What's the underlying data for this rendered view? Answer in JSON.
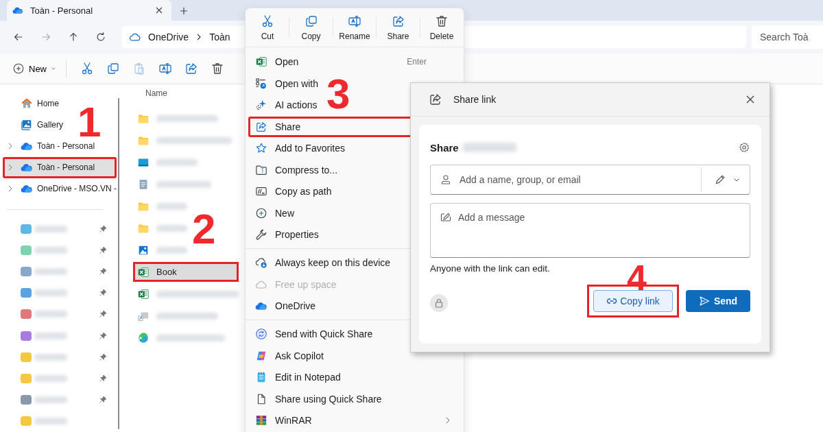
{
  "tab": {
    "title": "Toàn - Personal"
  },
  "address": {
    "crumbs": [
      "OneDrive",
      "Toàn"
    ],
    "search_placeholder": "Search Toà"
  },
  "toolbar": {
    "new_label": "New",
    "buttons": [
      {
        "kind": "cut",
        "disabled": false
      },
      {
        "kind": "copy",
        "disabled": false
      },
      {
        "kind": "paste",
        "disabled": true
      },
      {
        "kind": "rename",
        "disabled": false
      },
      {
        "kind": "share",
        "disabled": false
      },
      {
        "kind": "delete",
        "disabled": false
      }
    ]
  },
  "nav": {
    "items": [
      {
        "label": "Home",
        "kind": "home",
        "expandable": false,
        "selected": false,
        "highlighted": false
      },
      {
        "label": "Gallery",
        "kind": "gallery",
        "expandable": false,
        "selected": false,
        "highlighted": false
      },
      {
        "label": "Toàn - Personal",
        "kind": "onedrive",
        "expandable": true,
        "selected": false,
        "highlighted": false
      },
      {
        "label": "Toàn - Personal",
        "kind": "onedrive",
        "expandable": true,
        "selected": true,
        "highlighted": true
      },
      {
        "label": "OneDrive - MSO.VN -",
        "kind": "onedrive",
        "expandable": true,
        "selected": false,
        "highlighted": false
      }
    ],
    "pinned": [
      {
        "color": "#5fb7e5",
        "pinned": true
      },
      {
        "color": "#7fd3b0",
        "pinned": true
      },
      {
        "color": "#8aa6c8",
        "pinned": true
      },
      {
        "color": "#5aa2e0",
        "pinned": true
      },
      {
        "color": "#e07a7a",
        "pinned": true
      },
      {
        "color": "#a97be0",
        "pinned": true
      },
      {
        "color": "#f5c842",
        "pinned": true
      },
      {
        "color": "#f5c842",
        "pinned": true
      },
      {
        "color": "#8a98aa",
        "pinned": true
      },
      {
        "color": "#f5c842",
        "pinned": false
      }
    ]
  },
  "files": {
    "column": "Name",
    "rows": [
      {
        "kind": "folder",
        "blurred": true,
        "selected": false,
        "highlighted": false
      },
      {
        "kind": "folder",
        "blurred": true,
        "selected": false,
        "highlighted": false
      },
      {
        "kind": "screen",
        "blurred": true,
        "selected": false,
        "highlighted": false
      },
      {
        "kind": "doc",
        "blurred": true,
        "selected": false,
        "highlighted": false
      },
      {
        "kind": "folder",
        "blurred": true,
        "selected": false,
        "highlighted": false
      },
      {
        "kind": "folder",
        "blurred": true,
        "selected": false,
        "highlighted": false
      },
      {
        "kind": "image",
        "blurred": true,
        "selected": false,
        "highlighted": false
      },
      {
        "kind": "excel",
        "name": "Book",
        "blurred": false,
        "selected": true,
        "highlighted": true
      },
      {
        "kind": "excel",
        "blurred": true,
        "selected": false,
        "highlighted": false
      },
      {
        "kind": "shortcut",
        "blurred": true,
        "selected": false,
        "highlighted": false
      },
      {
        "kind": "browser",
        "blurred": true,
        "selected": false,
        "highlighted": false
      }
    ]
  },
  "context_menu": {
    "actions": [
      {
        "label": "Cut",
        "kind": "cut"
      },
      {
        "label": "Copy",
        "kind": "copy"
      },
      {
        "label": "Rename",
        "kind": "rename"
      },
      {
        "label": "Share",
        "kind": "share"
      },
      {
        "label": "Delete",
        "kind": "delete"
      }
    ],
    "groups": [
      [
        {
          "label": "Open",
          "kind": "excel",
          "shortcut": "Enter",
          "disabled": false,
          "highlighted": false
        },
        {
          "label": "Open with",
          "kind": "openwith",
          "disabled": false,
          "highlighted": false
        },
        {
          "label": "AI actions",
          "kind": "ai",
          "disabled": false,
          "highlighted": false
        },
        {
          "label": "Share",
          "kind": "share",
          "disabled": false,
          "highlighted": true
        },
        {
          "label": "Add to Favorites",
          "kind": "star",
          "disabled": false,
          "highlighted": false
        },
        {
          "label": "Compress to...",
          "kind": "compress",
          "disabled": false,
          "highlighted": false
        },
        {
          "label": "Copy as path",
          "kind": "path",
          "disabled": false,
          "highlighted": false
        },
        {
          "label": "New",
          "kind": "new",
          "disabled": false,
          "highlighted": false
        },
        {
          "label": "Properties",
          "kind": "properties",
          "disabled": false,
          "highlighted": false
        }
      ],
      [
        {
          "label": "Always keep on this device",
          "kind": "keep",
          "disabled": false,
          "highlighted": false
        },
        {
          "label": "Free up space",
          "kind": "cloud",
          "disabled": true,
          "highlighted": false
        },
        {
          "label": "OneDrive",
          "kind": "onedrive",
          "disabled": false,
          "highlighted": false
        }
      ],
      [
        {
          "label": "Send with Quick Share",
          "kind": "quickshare",
          "disabled": false,
          "highlighted": false
        },
        {
          "label": "Ask Copilot",
          "kind": "copilot",
          "disabled": false,
          "highlighted": false
        },
        {
          "label": "Edit in Notepad",
          "kind": "notepad",
          "disabled": false,
          "highlighted": false
        },
        {
          "label": "Share using Quick Share",
          "kind": "file",
          "disabled": false,
          "highlighted": false
        },
        {
          "label": "WinRAR",
          "kind": "winrar",
          "submenu": true,
          "disabled": false,
          "highlighted": false
        }
      ]
    ]
  },
  "share_dialog": {
    "title": "Share link",
    "heading": "Share",
    "recipient_placeholder": "Add a name, group, or email",
    "message_placeholder": "Add a message",
    "permission": "Anyone with the link can edit.",
    "copy_button": "Copy link",
    "copy_highlighted": true,
    "send_button": "Send"
  },
  "steps": [
    "1",
    "2",
    "3",
    "4"
  ]
}
